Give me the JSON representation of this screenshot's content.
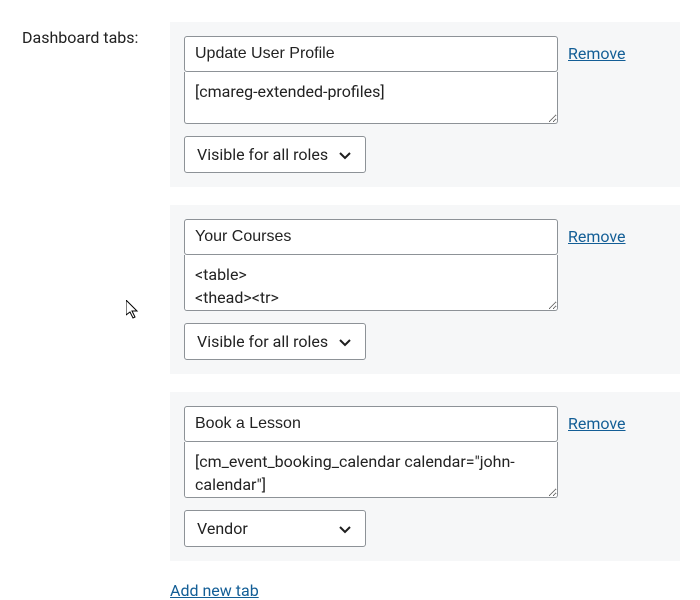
{
  "label": "Dashboard tabs:",
  "remove_label": "Remove",
  "add_new_label": "Add new tab",
  "role_options_default": "Visible for all roles",
  "tabs": [
    {
      "title": "Update User Profile",
      "content": "[cmareg-extended-profiles]",
      "role": "Visible for all roles",
      "ta_class": "ta-short"
    },
    {
      "title": "Your Courses",
      "content": "<table>\n<thead><tr>",
      "role": "Visible for all roles",
      "ta_class": "ta-mid"
    },
    {
      "title": "Book a Lesson",
      "content": "[cm_event_booking_calendar calendar=\"john-calendar\"]",
      "role": "Vendor",
      "ta_class": "ta-tall"
    }
  ]
}
